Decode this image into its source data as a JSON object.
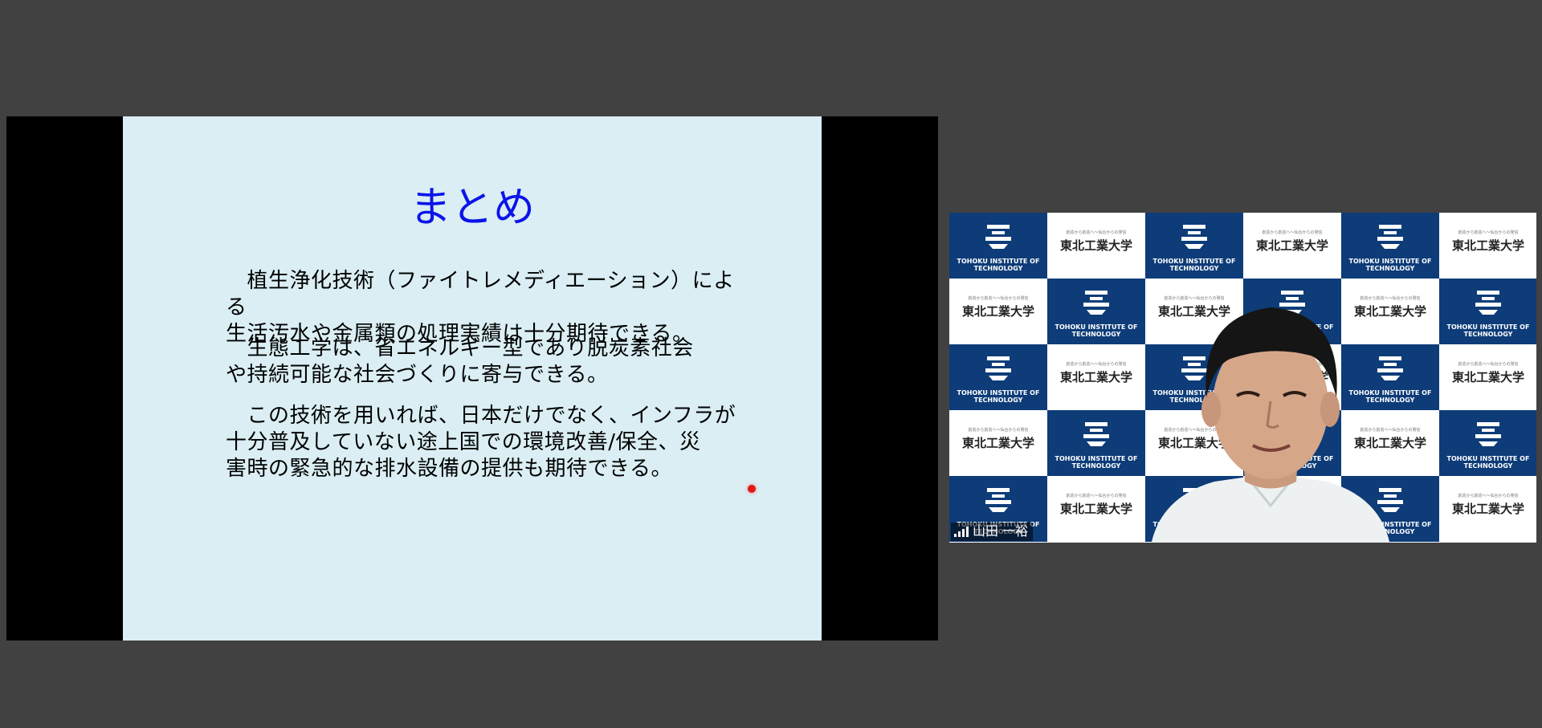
{
  "slide": {
    "title": "まとめ",
    "paragraphs": [
      "　植生浄化技術（ファイトレメディエーション）による\n生活汚水や金属類の処理実績は十分期待できる。",
      "　生態工学は、省エネルギー型であり脱炭素社会\nや持続可能な社会づくりに寄与できる。",
      "　この技術を用いれば、日本だけでなく、インフラが\n十分普及していない途上国での環境改善/保全、災\n害時の緊急的な排水設備の提供も期待できる。"
    ]
  },
  "video": {
    "participant_name": "山田 一裕",
    "backdrop": {
      "university_name": "東北工業大学",
      "university_name_en": "TOHOKU INSTITUTE OF TECHNOLOGY",
      "tagline": "創造から創造へ〜仙台からの発信"
    }
  },
  "colors": {
    "background": "#414141",
    "slide_bg": "#daeef3",
    "title": "#0b14ea",
    "backdrop_navy": "#0d3c78"
  }
}
